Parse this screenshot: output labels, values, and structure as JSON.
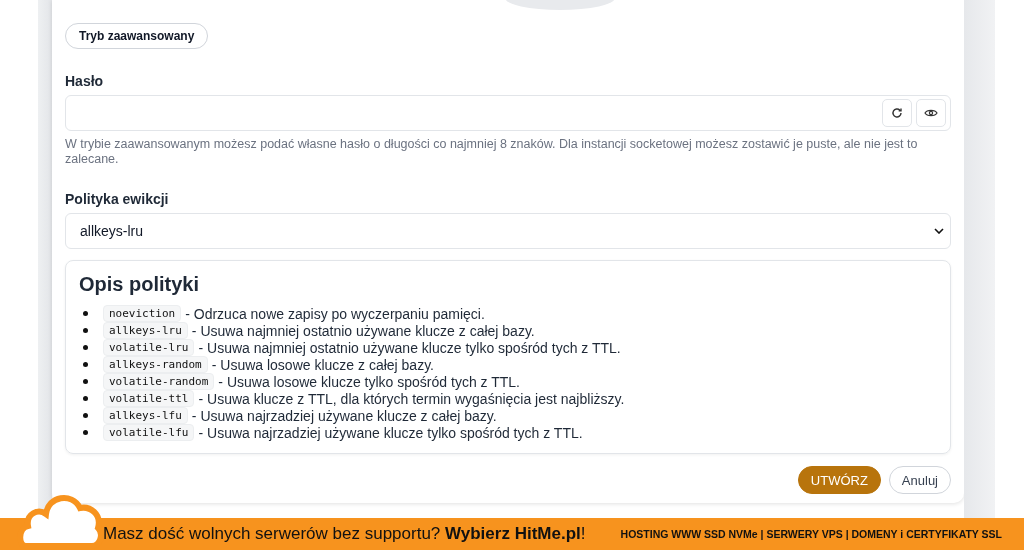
{
  "advanced_button": {
    "label": "Tryb zaawansowany"
  },
  "password": {
    "label": "Hasło",
    "help": "W trybie zaawansowanym możesz podać własne hasło o długości co najmniej 8 znaków. Dla instancji socketowej możesz zostawić je puste, ale nie jest to zalecane."
  },
  "eviction": {
    "label": "Polityka ewikcji",
    "value": "allkeys-lru"
  },
  "policy_box": {
    "title": "Opis polityki",
    "items": [
      {
        "code": "noeviction",
        "description": "- Odrzuca nowe zapisy po wyczerpaniu pamięci."
      },
      {
        "code": "allkeys-lru",
        "description": "- Usuwa najmniej ostatnio używane klucze z całej bazy."
      },
      {
        "code": "volatile-lru",
        "description": "- Usuwa najmniej ostatnio używane klucze tylko spośród tych z TTL."
      },
      {
        "code": "allkeys-random",
        "description": "- Usuwa losowe klucze z całej bazy."
      },
      {
        "code": "volatile-random",
        "description": "- Usuwa losowe klucze tylko spośród tych z TTL."
      },
      {
        "code": "volatile-ttl",
        "description": "- Usuwa klucze z TTL, dla których termin wygaśnięcia jest najbliższy."
      },
      {
        "code": "allkeys-lfu",
        "description": "- Usuwa najrzadziej używane klucze z całej bazy."
      },
      {
        "code": "volatile-lfu",
        "description": "- Usuwa najrzadziej używane klucze tylko spośród tych z TTL."
      }
    ]
  },
  "actions": [
    {
      "label": "UTWÓRZ",
      "kind": "primary"
    },
    {
      "label": "Anuluj",
      "kind": "secondary"
    }
  ],
  "banner": {
    "message": "Masz dość wolnych serwerów bez supportu? **Wybierz HitMe.pl**!",
    "services": "HOSTING WWW SSD NVMe | SERWERY VPS | DOMENY i CERTYFIKATY SSL"
  }
}
